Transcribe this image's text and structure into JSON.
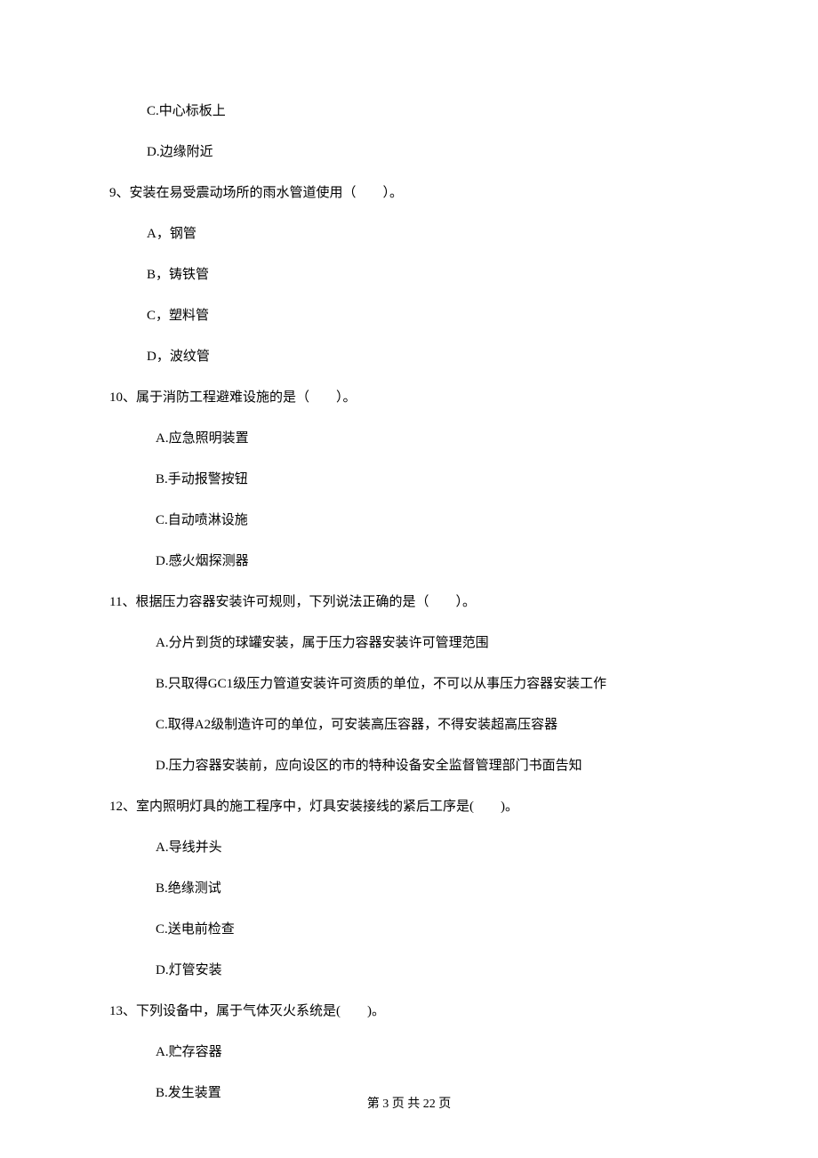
{
  "q8": {
    "options": {
      "c": "C.中心标板上",
      "d": "D.边缘附近"
    }
  },
  "q9": {
    "stem": "9、安装在易受震动场所的雨水管道使用（　　）。",
    "options": {
      "a": "A，钢管",
      "b": "B，铸铁管",
      "c": "C，塑料管",
      "d": "D，波纹管"
    }
  },
  "q10": {
    "stem": "10、属于消防工程避难设施的是（　　）。",
    "options": {
      "a": "A.应急照明装置",
      "b": "B.手动报警按钮",
      "c": "C.自动喷淋设施",
      "d": "D.感火烟探测器"
    }
  },
  "q11": {
    "stem": "11、根据压力容器安装许可规则，下列说法正确的是（　　）。",
    "options": {
      "a": "A.分片到货的球罐安装，属于压力容器安装许可管理范围",
      "b": "B.只取得GC1级压力管道安装许可资质的单位，不可以从事压力容器安装工作",
      "c": "C.取得A2级制造许可的单位，可安装高压容器，不得安装超高压容器",
      "d": "D.压力容器安装前，应向设区的市的特种设备安全监督管理部门书面告知"
    }
  },
  "q12": {
    "stem": "12、室内照明灯具的施工程序中，灯具安装接线的紧后工序是(　　)。",
    "options": {
      "a": "A.导线并头",
      "b": "B.绝缘测试",
      "c": "C.送电前检查",
      "d": "D.灯管安装"
    }
  },
  "q13": {
    "stem": "13、下列设备中，属于气体灭火系统是(　　)。",
    "options": {
      "a": "A.贮存容器",
      "b": "B.发生装置"
    }
  },
  "footer": "第 3 页 共 22 页"
}
